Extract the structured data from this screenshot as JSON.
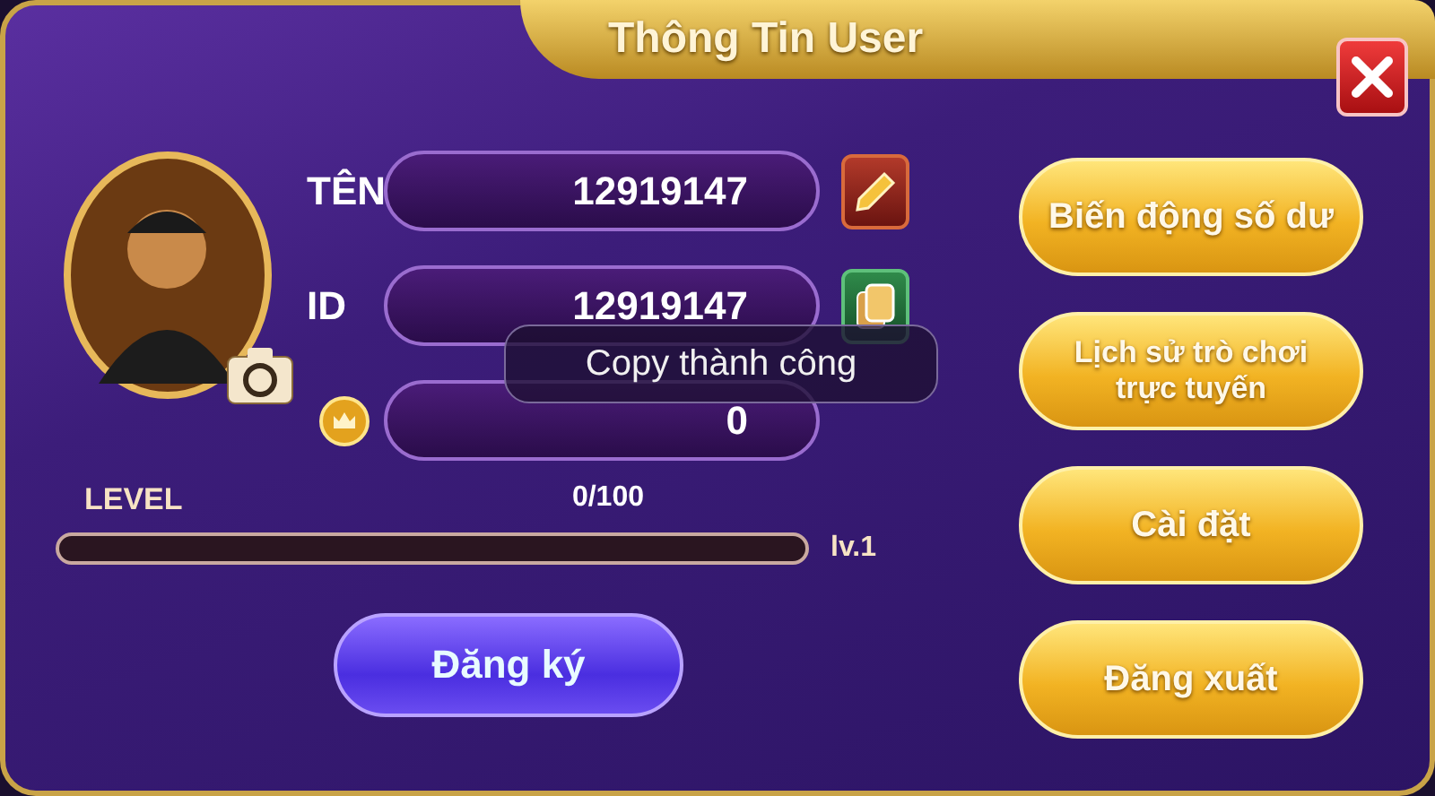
{
  "title": "Thông Tin User",
  "fields": [
    {
      "kind": "name",
      "label": "TÊN",
      "value": "12919147"
    },
    {
      "kind": "id",
      "label": "ID",
      "value": "12919147"
    },
    {
      "kind": "balance",
      "value": "0"
    }
  ],
  "level": {
    "label": "LEVEL",
    "progress": "0/100",
    "level": 0,
    "rank": "lv.1"
  },
  "register_button": "Đăng ký",
  "menu_buttons": [
    "Biến động số dư",
    "Lịch sử trò chơi trực tuyến",
    "Cài đặt",
    "Đăng xuất"
  ],
  "toast": "Copy thành công"
}
